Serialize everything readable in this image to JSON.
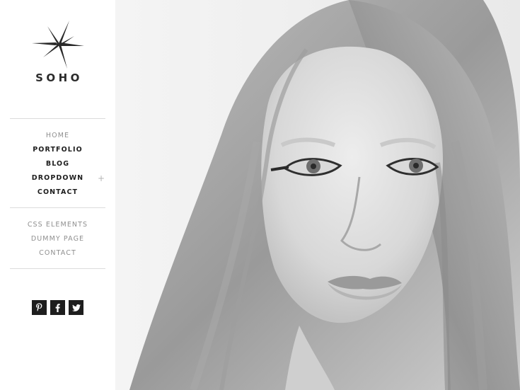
{
  "brand": {
    "name": "SOHO",
    "logo": "starburst-logo-icon"
  },
  "nav": {
    "primary": [
      {
        "label": "HOME"
      },
      {
        "label": "PORTFOLIO"
      },
      {
        "label": "BLOG"
      },
      {
        "label": "DROPDOWN",
        "submenu_indicator": "+"
      },
      {
        "label": "CONTACT"
      }
    ],
    "secondary": [
      {
        "label": "CSS ELEMENTS"
      },
      {
        "label": "DUMMY PAGE"
      },
      {
        "label": "CONTACT"
      }
    ]
  },
  "social": [
    {
      "icon": "pinterest-icon",
      "glyph": "P"
    },
    {
      "icon": "facebook-icon",
      "glyph": "f"
    },
    {
      "icon": "twitter-icon",
      "glyph": "t"
    }
  ],
  "colors": {
    "sidebar_bg": "#ffffff",
    "text_dark": "#1e1e1e",
    "text_muted": "#8f8f8f",
    "divider": "#dcdcdc",
    "social_bg": "#1e1e1e"
  },
  "hero": {
    "description_icon": "portrait-photo"
  }
}
